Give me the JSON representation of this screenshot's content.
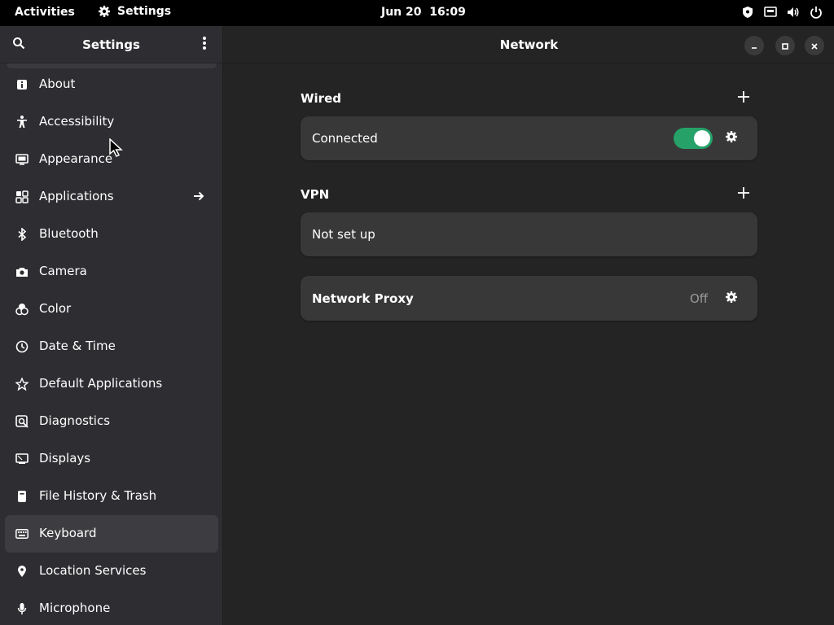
{
  "topbar": {
    "activities": "Activities",
    "app_name": "Settings",
    "date": "Jun 20",
    "time": "16:09",
    "tray_icons": [
      "shield-icon",
      "network-wired-icon",
      "volume-icon",
      "power-icon"
    ]
  },
  "sidebar": {
    "title": "Settings",
    "items": [
      {
        "label": "About",
        "icon": "info-icon"
      },
      {
        "label": "Accessibility",
        "icon": "accessibility-icon"
      },
      {
        "label": "Appearance",
        "icon": "appearance-icon"
      },
      {
        "label": "Applications",
        "icon": "applications-icon",
        "has_arrow": true
      },
      {
        "label": "Bluetooth",
        "icon": "bluetooth-icon"
      },
      {
        "label": "Camera",
        "icon": "camera-icon"
      },
      {
        "label": "Color",
        "icon": "color-icon"
      },
      {
        "label": "Date & Time",
        "icon": "clock-icon"
      },
      {
        "label": "Default Applications",
        "icon": "star-icon"
      },
      {
        "label": "Diagnostics",
        "icon": "diagnostics-icon"
      },
      {
        "label": "Displays",
        "icon": "display-icon"
      },
      {
        "label": "File History & Trash",
        "icon": "file-icon"
      },
      {
        "label": "Keyboard",
        "icon": "keyboard-icon",
        "selected": true
      },
      {
        "label": "Location Services",
        "icon": "location-icon"
      },
      {
        "label": "Microphone",
        "icon": "microphone-icon"
      }
    ]
  },
  "main": {
    "title": "Network",
    "wired": {
      "title": "Wired",
      "status": "Connected",
      "toggle_on": true
    },
    "vpn": {
      "title": "VPN",
      "status": "Not set up"
    },
    "proxy": {
      "label": "Network Proxy",
      "value": "Off"
    }
  },
  "colors": {
    "accent_toggle": "#26a269",
    "sidebar_bg": "#2e2e32",
    "main_bg": "#242424",
    "card_bg": "#383838",
    "topbar_bg": "#000000"
  }
}
